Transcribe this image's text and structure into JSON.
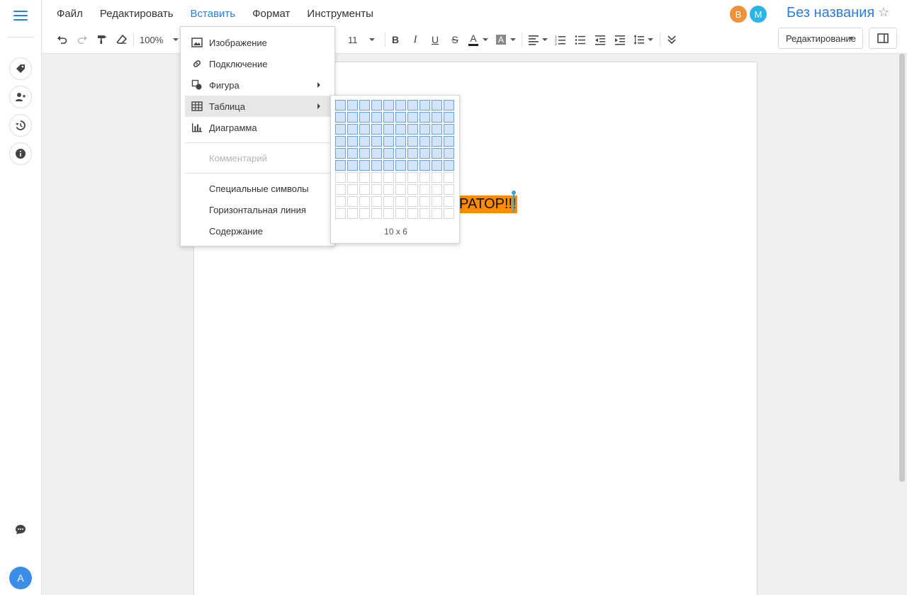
{
  "menu": [
    "Файл",
    "Редактировать",
    "Вставить",
    "Формат",
    "Инструменты"
  ],
  "collaborators": [
    {
      "initial": "В",
      "color": "#f0923a"
    },
    {
      "initial": "М",
      "color": "#29b5e8"
    }
  ],
  "doc_title": "Без названия",
  "toolbar": {
    "zoom": "100%",
    "font_size": "11",
    "mode": "Редактирование"
  },
  "user_avatar": "A",
  "document": {
    "selected_text": "РАТОР!!!",
    "highlight_color": "#ff8c00"
  },
  "insert_menu": {
    "items": [
      {
        "label": "Изображение",
        "icon": "image-icon"
      },
      {
        "label": "Подключение",
        "icon": "link-icon"
      },
      {
        "label": "Фигура",
        "icon": "shape-icon",
        "submenu": true
      },
      {
        "label": "Таблица",
        "icon": "table-icon",
        "submenu": true,
        "hover": true
      },
      {
        "label": "Диаграмма",
        "icon": "chart-icon"
      },
      {
        "label": "Комментарий",
        "disabled": true
      },
      {
        "label": "Специальные символы"
      },
      {
        "label": "Горизонтальная линия"
      },
      {
        "label": "Содержание"
      }
    ]
  },
  "table_picker": {
    "columns": 10,
    "rows": 10,
    "selected_cols": 10,
    "selected_rows": 6,
    "size_label": "10 x 6"
  }
}
